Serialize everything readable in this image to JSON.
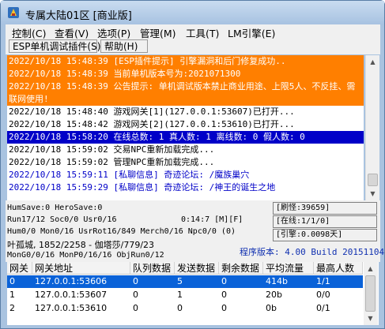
{
  "window": {
    "title": "专属大陆01区 [商业版]"
  },
  "menu": [
    {
      "label": "控制(C)"
    },
    {
      "label": "查看(V)"
    },
    {
      "label": "选项(P)"
    },
    {
      "label": "管理(M)"
    },
    {
      "label": "工具(T)"
    },
    {
      "label": "LM引擎(E)"
    }
  ],
  "toolbar": {
    "esp_label": "ESP单机调试插件(S)",
    "help_label": "帮助(H)"
  },
  "log_lines": [
    {
      "time": "2022/10/18 15:48:39",
      "text": "[ESP插件提示] 引擎漏洞和后门修复成功.."
    },
    {
      "time": "2022/10/18 15:48:39",
      "text": "当前单机版本号为:2021071300"
    },
    {
      "time": "2022/10/18 15:48:39",
      "text": "公告提示: 单机调试版本禁止商业用途、上限5人、不反挂、需"
    },
    {
      "time": "",
      "text": "联网使用!"
    },
    {
      "time": "2022/10/18 15:48:40",
      "text": "游戏网关[1](127.0.0.1:53607)已打开..."
    },
    {
      "time": "2022/10/18 15:48:42",
      "text": "游戏网关[2](127.0.0.1:53610)已打开..."
    },
    {
      "time": "2022/10/18 15:58:20",
      "text": "在线总数: 1 真人数: 1 离线数: 0 假人数: 0"
    },
    {
      "time": "2022/10/18 15:59:02",
      "text": "交易NPC重新加载完成..."
    },
    {
      "time": "2022/10/18 15:59:02",
      "text": "管理NPC重新加载完成..."
    },
    {
      "time": "2022/10/18 15:59:11",
      "text": "[私聊信息] 奇迹论坛: /魔族巢穴"
    },
    {
      "time": "2022/10/18 15:59:29",
      "text": "[私聊信息] 奇迹论坛: /神王的诞生之地"
    }
  ],
  "log_colors": {
    "warning_bg": "#ff7f00",
    "highlight_bg": "#0000c8",
    "private_msg": "#0000c8",
    "normal": "#000000"
  },
  "status": {
    "hum_save": "HumSave:0 HeroSave:0",
    "refresh": "[刷怪:39659]",
    "run": "Run17/12 Soc0/0 Usr0/16",
    "time": "0:14:7 [M][F]",
    "online": "[在线:1/1/0]",
    "hum": "Hum0/0 Mon0/16 UsrRot16/849 Merch0/16 Npc0/0 (0)",
    "engine": "[引擎:0.0098天]",
    "location": "叶孤城, 1852/2258 - 伽塔莎/779/23",
    "mongo": "MonG0/0/16 MonP0/16/16 ObjRun0/12",
    "version": "程序版本: 4.00 Build 20151104"
  },
  "gateway_table": {
    "columns": [
      "网关",
      "网关地址",
      "队列数据",
      "发送数据",
      "剩余数据",
      "平均流量",
      "最高人数"
    ],
    "rows": [
      [
        "0",
        "127.0.0.1:53606",
        "0",
        "5",
        "0",
        "414b",
        "1/1"
      ],
      [
        "1",
        "127.0.0.1:53607",
        "0",
        "1",
        "0",
        "20b",
        "0/0"
      ],
      [
        "2",
        "127.0.0.1:53610",
        "0",
        "0",
        "0",
        "0b",
        "0/1"
      ]
    ],
    "selected_row": 0
  }
}
